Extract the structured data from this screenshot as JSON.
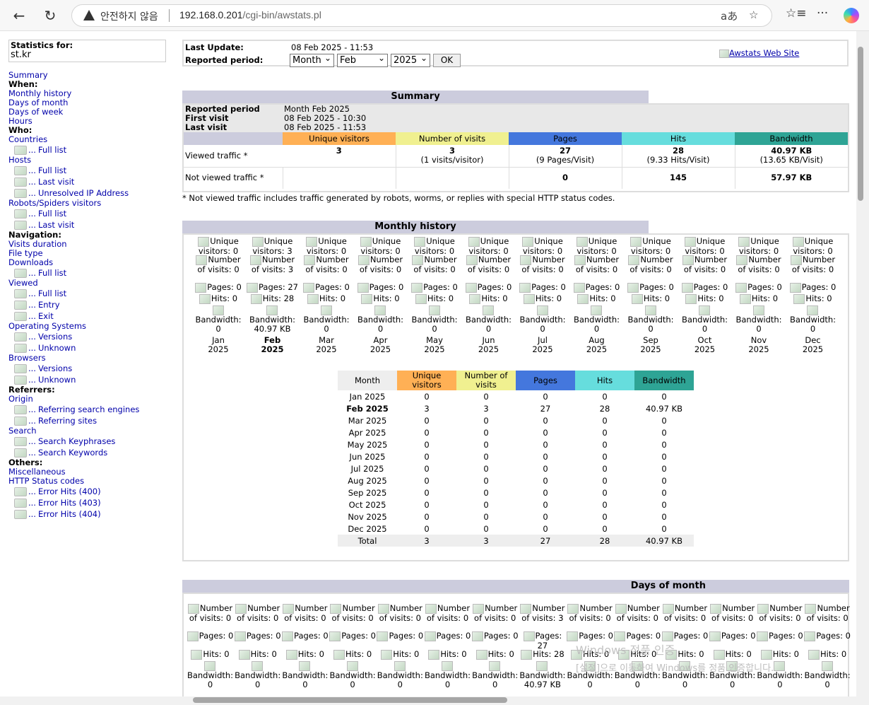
{
  "browser": {
    "insecure_label": "안전하지 않음",
    "url_host": "192.168.0.201",
    "url_path": "/cgi-bin/awstats.pl"
  },
  "sidebar": {
    "stats_for_label": "Statistics for:",
    "site": "st.kr",
    "summary": "Summary",
    "when": "When:",
    "monthly_history": "Monthly history",
    "days_of_month": "Days of month",
    "days_of_week": "Days of week",
    "hours": "Hours",
    "who": "Who:",
    "countries": "Countries",
    "countries_full": "Full list",
    "hosts": "Hosts",
    "hosts_full": "Full list",
    "hosts_last": "Last visit",
    "hosts_unresolved": "Unresolved IP Address",
    "robots": "Robots/Spiders visitors",
    "robots_full": "Full list",
    "robots_last": "Last visit",
    "navigation": "Navigation:",
    "visits_duration": "Visits duration",
    "file_type": "File type",
    "downloads": "Downloads",
    "downloads_full": "Full list",
    "viewed": "Viewed",
    "viewed_full": "Full list",
    "viewed_entry": "Entry",
    "viewed_exit": "Exit",
    "os": "Operating Systems",
    "os_versions": "Versions",
    "os_unknown": "Unknown",
    "browsers": "Browsers",
    "browsers_versions": "Versions",
    "browsers_unknown": "Unknown",
    "referrers": "Referrers:",
    "origin": "Origin",
    "ref_search_engines": "Referring search engines",
    "ref_sites": "Referring sites",
    "search": "Search",
    "search_keyphrases": "Search Keyphrases",
    "search_keywords": "Search Keywords",
    "others": "Others:",
    "misc": "Miscellaneous",
    "http_status": "HTTP Status codes",
    "err400": "Error Hits (400)",
    "err403": "Error Hits (403)",
    "err404": "Error Hits (404)",
    "dots": "..."
  },
  "top": {
    "last_update_label": "Last Update:",
    "last_update": "08 Feb 2025 - 11:53",
    "reported_period_label": "Reported period:",
    "period_type": "Month",
    "period_month": "Feb",
    "period_year": "2025",
    "ok": "OK",
    "awstats_link": "Awstats Web Site"
  },
  "summary": {
    "title": "Summary",
    "reported_period_label": "Reported period",
    "reported_period": "Month Feb 2025",
    "first_visit_label": "First visit",
    "first_visit": "08 Feb 2025 - 10:30",
    "last_visit_label": "Last visit",
    "last_visit": "08 Feb 2025 - 11:53",
    "col_unique": "Unique visitors",
    "col_visits": "Number of visits",
    "col_pages": "Pages",
    "col_hits": "Hits",
    "col_bandwidth": "Bandwidth",
    "viewed_label": "Viewed traffic *",
    "viewed_unique": "3",
    "viewed_visits": "3",
    "viewed_visits_sub": "(1 visits/visitor)",
    "viewed_pages": "27",
    "viewed_pages_sub": "(9 Pages/Visit)",
    "viewed_hits": "28",
    "viewed_hits_sub": "(9.33 Hits/Visit)",
    "viewed_bw": "40.97 KB",
    "viewed_bw_sub": "(13.65 KB/Visit)",
    "notviewed_label": "Not viewed traffic *",
    "notviewed_pages": "0",
    "notviewed_hits": "145",
    "notviewed_bw": "57.97 KB",
    "note": "* Not viewed traffic includes traffic generated by robots, worms, or replies with special HTTP status codes."
  },
  "monthly": {
    "title": "Monthly history",
    "columns": [
      {
        "uv": "Unique visitors: 0",
        "nv": "Number of visits: 0",
        "pg": "Pages: 0",
        "ht": "Hits: 0",
        "bw": "Bandwidth: 0",
        "m": "Jan",
        "y": "2025"
      },
      {
        "uv": "Unique visitors: 3",
        "nv": "Number of visits: 3",
        "pg": "Pages: 27",
        "ht": "Hits: 28",
        "bw": "Bandwidth: 40.97 KB",
        "m": "Feb",
        "y": "2025"
      },
      {
        "uv": "Unique visitors: 0",
        "nv": "Number of visits: 0",
        "pg": "Pages: 0",
        "ht": "Hits: 0",
        "bw": "Bandwidth: 0",
        "m": "Mar",
        "y": "2025"
      },
      {
        "uv": "Unique visitors: 0",
        "nv": "Number of visits: 0",
        "pg": "Pages: 0",
        "ht": "Hits: 0",
        "bw": "Bandwidth: 0",
        "m": "Apr",
        "y": "2025"
      },
      {
        "uv": "Unique visitors: 0",
        "nv": "Number of visits: 0",
        "pg": "Pages: 0",
        "ht": "Hits: 0",
        "bw": "Bandwidth: 0",
        "m": "May",
        "y": "2025"
      },
      {
        "uv": "Unique visitors: 0",
        "nv": "Number of visits: 0",
        "pg": "Pages: 0",
        "ht": "Hits: 0",
        "bw": "Bandwidth: 0",
        "m": "Jun",
        "y": "2025"
      },
      {
        "uv": "Unique visitors: 0",
        "nv": "Number of visits: 0",
        "pg": "Pages: 0",
        "ht": "Hits: 0",
        "bw": "Bandwidth: 0",
        "m": "Jul",
        "y": "2025"
      },
      {
        "uv": "Unique visitors: 0",
        "nv": "Number of visits: 0",
        "pg": "Pages: 0",
        "ht": "Hits: 0",
        "bw": "Bandwidth: 0",
        "m": "Aug",
        "y": "2025"
      },
      {
        "uv": "Unique visitors: 0",
        "nv": "Number of visits: 0",
        "pg": "Pages: 0",
        "ht": "Hits: 0",
        "bw": "Bandwidth: 0",
        "m": "Sep",
        "y": "2025"
      },
      {
        "uv": "Unique visitors: 0",
        "nv": "Number of visits: 0",
        "pg": "Pages: 0",
        "ht": "Hits: 0",
        "bw": "Bandwidth: 0",
        "m": "Oct",
        "y": "2025"
      },
      {
        "uv": "Unique visitors: 0",
        "nv": "Number of visits: 0",
        "pg": "Pages: 0",
        "ht": "Hits: 0",
        "bw": "Bandwidth: 0",
        "m": "Nov",
        "y": "2025"
      },
      {
        "uv": "Unique visitors: 0",
        "nv": "Number of visits: 0",
        "pg": "Pages: 0",
        "ht": "Hits: 0",
        "bw": "Bandwidth: 0",
        "m": "Dec",
        "y": "2025"
      }
    ],
    "table_headers": [
      "Month",
      "Unique visitors",
      "Number of visits",
      "Pages",
      "Hits",
      "Bandwidth"
    ],
    "rows": [
      [
        "Jan 2025",
        "0",
        "0",
        "0",
        "0",
        "0"
      ],
      [
        "Feb 2025",
        "3",
        "3",
        "27",
        "28",
        "40.97 KB"
      ],
      [
        "Mar 2025",
        "0",
        "0",
        "0",
        "0",
        "0"
      ],
      [
        "Apr 2025",
        "0",
        "0",
        "0",
        "0",
        "0"
      ],
      [
        "May 2025",
        "0",
        "0",
        "0",
        "0",
        "0"
      ],
      [
        "Jun 2025",
        "0",
        "0",
        "0",
        "0",
        "0"
      ],
      [
        "Jul 2025",
        "0",
        "0",
        "0",
        "0",
        "0"
      ],
      [
        "Aug 2025",
        "0",
        "0",
        "0",
        "0",
        "0"
      ],
      [
        "Sep 2025",
        "0",
        "0",
        "0",
        "0",
        "0"
      ],
      [
        "Oct 2025",
        "0",
        "0",
        "0",
        "0",
        "0"
      ],
      [
        "Nov 2025",
        "0",
        "0",
        "0",
        "0",
        "0"
      ],
      [
        "Dec 2025",
        "0",
        "0",
        "0",
        "0",
        "0"
      ]
    ],
    "total": [
      "Total",
      "3",
      "3",
      "27",
      "28",
      "40.97 KB"
    ]
  },
  "days": {
    "title": "Days of month",
    "columns": [
      {
        "nv": "Number of visits: 0",
        "pg": "Pages: 0",
        "ht": "Hits: 0",
        "bw": "Bandwidth: 0"
      },
      {
        "nv": "Number of visits: 0",
        "pg": "Pages: 0",
        "ht": "Hits: 0",
        "bw": "Bandwidth: 0"
      },
      {
        "nv": "Number of visits: 0",
        "pg": "Pages: 0",
        "ht": "Hits: 0",
        "bw": "Bandwidth: 0"
      },
      {
        "nv": "Number of visits: 0",
        "pg": "Pages: 0",
        "ht": "Hits: 0",
        "bw": "Bandwidth: 0"
      },
      {
        "nv": "Number of visits: 0",
        "pg": "Pages: 0",
        "ht": "Hits: 0",
        "bw": "Bandwidth: 0"
      },
      {
        "nv": "Number of visits: 0",
        "pg": "Pages: 0",
        "ht": "Hits: 0",
        "bw": "Bandwidth: 0"
      },
      {
        "nv": "Number of visits: 0",
        "pg": "Pages: 0",
        "ht": "Hits: 0",
        "bw": "Bandwidth: 0"
      },
      {
        "nv": "Number of visits: 3",
        "pg": "Pages: 27",
        "ht": "Hits: 28",
        "bw": "Bandwidth: 40.97 KB"
      },
      {
        "nv": "Number of visits: 0",
        "pg": "Pages: 0",
        "ht": "Hits: 0",
        "bw": "Bandwidth: 0"
      },
      {
        "nv": "Number of visits: 0",
        "pg": "Pages: 0",
        "ht": "Hits: 0",
        "bw": "Bandwidth: 0"
      },
      {
        "nv": "Number of visits: 0",
        "pg": "Pages: 0",
        "ht": "Hits: 0",
        "bw": "Bandwidth: 0"
      },
      {
        "nv": "Number of visits: 0",
        "pg": "Pages: 0",
        "ht": "Hits: 0",
        "bw": "Bandwidth: 0"
      },
      {
        "nv": "Number of visits: 0",
        "pg": "Pages: 0",
        "ht": "Hits: 0",
        "bw": "Bandwidth: 0"
      },
      {
        "nv": "Number of visits: 0",
        "pg": "Pages: 0",
        "ht": "Hits: 0",
        "bw": "Bandwidth: 0"
      }
    ]
  },
  "watermark": {
    "line1": "Windows 정품 인증",
    "line2": "[설정]으로 이동하여 Windows를 정품 인증합니다."
  },
  "colors": {
    "unique": "#ffb055",
    "visits": "#f0f090",
    "pages": "#4477dd",
    "hits": "#66dddd",
    "bandwidth": "#2ea495",
    "header_bg": "#ccccdd",
    "link": "#0000aa"
  }
}
